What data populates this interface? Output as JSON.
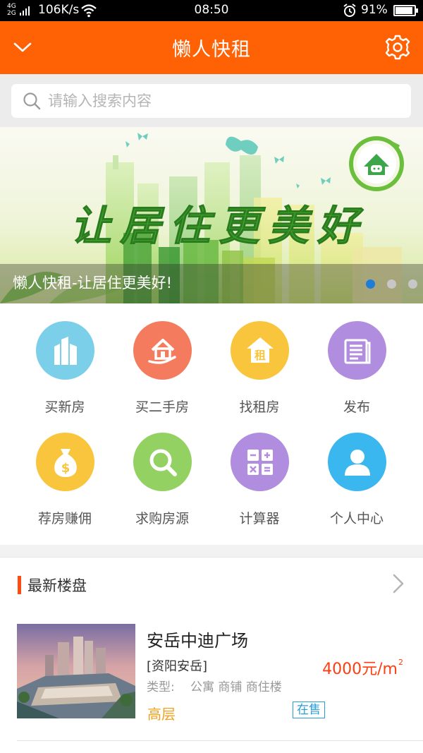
{
  "status_bar": {
    "network_type": "4G 2G",
    "speed": "106K/s",
    "time": "08:50",
    "battery_text": "91%",
    "battery_level": 0.91,
    "icons": [
      "signal-icon",
      "wifi-icon",
      "alarm-icon",
      "battery-icon"
    ]
  },
  "header": {
    "title": "懒人快租",
    "left_icon": "chevron-down-icon",
    "right_icon": "gear-icon"
  },
  "search": {
    "placeholder": "请输入搜索内容",
    "icon": "search-icon"
  },
  "banner": {
    "slogan": "让居住更美好",
    "caption": "懒人快租-让居住更美好!",
    "page_count": 3,
    "active_page": 1
  },
  "grid": {
    "items": [
      {
        "label": "买新房",
        "icon": "buildings-icon",
        "color": "#7ccfe9"
      },
      {
        "label": "买二手房",
        "icon": "house-hand-icon",
        "color": "#f47b5e"
      },
      {
        "label": "找租房",
        "icon": "rent-house-icon",
        "color": "#f8c53c"
      },
      {
        "label": "发布",
        "icon": "document-icon",
        "color": "#b18ddf"
      },
      {
        "label": "荐房赚佣",
        "icon": "money-bag-icon",
        "color": "#f8c53c"
      },
      {
        "label": "求购房源",
        "icon": "search-icon",
        "color": "#94d163"
      },
      {
        "label": "计算器",
        "icon": "calculator-icon",
        "color": "#b18ddf"
      },
      {
        "label": "个人中心",
        "icon": "user-icon",
        "color": "#3ab7ee"
      }
    ]
  },
  "latest": {
    "title": "最新楼盘",
    "listing": {
      "name": "安岳中迪广场",
      "area": "[资阳安岳]",
      "type_label": "类型:",
      "types": "公寓 商铺 商住楼",
      "price": "4000元/m",
      "price_sup": "2",
      "floor": "高层",
      "status": "在售"
    }
  },
  "colors": {
    "brand_orange": "#ff6105",
    "price_red": "#ff3d10",
    "floor_orange": "#f0a21f",
    "status_blue": "#2a9fd6",
    "dot_active": "#1f7cd8"
  }
}
